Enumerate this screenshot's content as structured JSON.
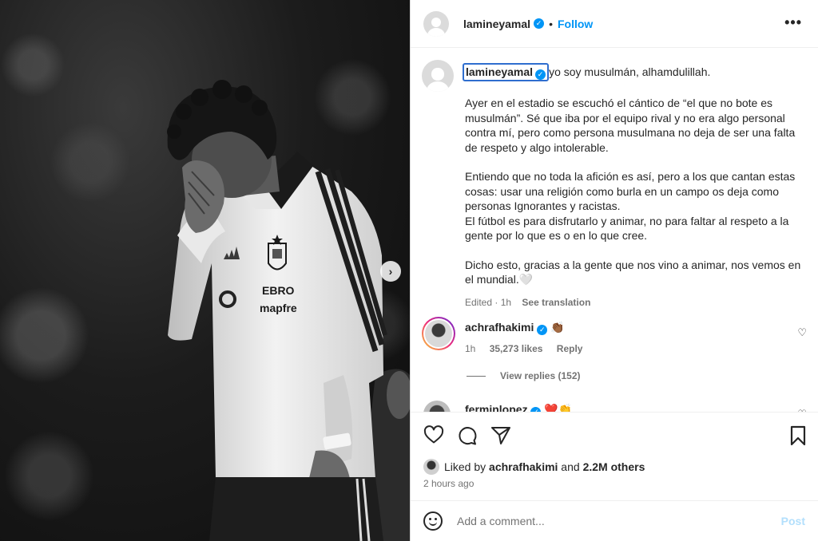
{
  "post": {
    "username": "lamineyamal",
    "follow_label": "Follow",
    "dot": "•",
    "more_label": "•••"
  },
  "caption": {
    "username": "lamineyamal",
    "first_line": "yo soy musulmán, alhamdulillah.",
    "paragraphs": [
      "Ayer en el estadio se escuchó el cántico de “el que no bote es musulmán”. Sé que iba por el equipo rival y no era algo personal contra mí, pero como persona musulmana no deja de ser una falta de respeto y algo intolerable.",
      "Entiendo que no toda la afición es así, pero a los que cantan estas cosas: usar una religión como burla en un campo os deja como personas Ignorantes y racistas.\nEl fútbol es para disfrutarlo y animar, no para faltar al respeto a la gente por lo que es o en lo que cree.",
      "Dicho esto, gracias a la gente que nos vino a animar, nos vemos en el mundial.🤍"
    ],
    "edited": "Edited · 1h",
    "see_translation": "See translation"
  },
  "comments": [
    {
      "username": "achrafhakimi",
      "text": "👏🏾",
      "time": "1h",
      "likes": "35,273 likes",
      "reply_label": "Reply",
      "view_replies": "View replies (152)"
    },
    {
      "username": "ferminlopez",
      "text": "❤️👏"
    }
  ],
  "likes": {
    "prefix": "Liked by ",
    "user": "achrafhakimi",
    "and": " and ",
    "others": "2.2M others"
  },
  "timestamp": "2 hours ago",
  "add_comment": {
    "placeholder": "Add a comment...",
    "post_label": "Post"
  },
  "photo_text": {
    "sponsor_1": "EBRO",
    "sponsor_2": "mapfre"
  },
  "colors": {
    "accent": "#0095f6",
    "muted": "#737373",
    "post_disabled": "#b2dffc"
  }
}
